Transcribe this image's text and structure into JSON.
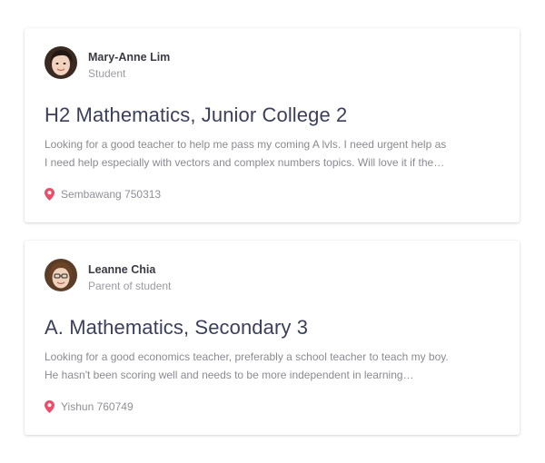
{
  "listings": [
    {
      "author_name": "Mary-Anne Lim",
      "author_role": "Student",
      "title": "H2 Mathematics, Junior College 2",
      "description_line1": "Looking for a good teacher to help me pass my coming A lvls. I need urgent help as",
      "description_line2": "I need help especially with vectors and complex numbers topics. Will love it if the…",
      "location": "Sembawang 750313"
    },
    {
      "author_name": "Leanne Chia",
      "author_role": "Parent of student",
      "title": "A. Mathematics, Secondary 3",
      "description_line1": "Looking for a good economics teacher, preferably a school teacher to teach my boy.",
      "description_line2": "He hasn't been scoring well and needs to be more independent in learning…",
      "location": "Yishun 760749"
    }
  ],
  "colors": {
    "title": "#3b3f5c",
    "pin": "#e8506a",
    "muted_text": "#8a8a92"
  },
  "icons": {
    "location": "map-pin-icon"
  }
}
